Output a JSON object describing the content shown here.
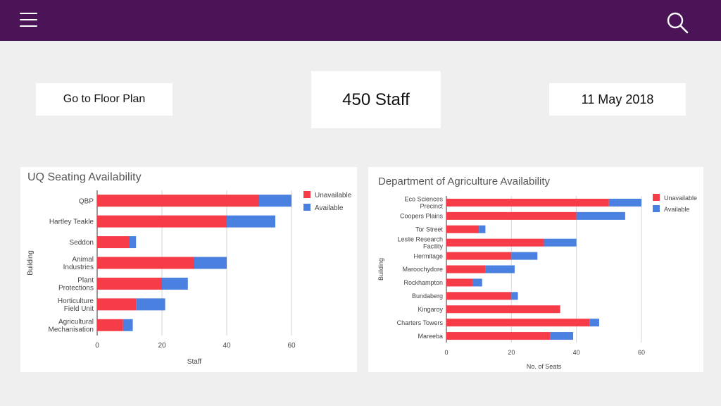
{
  "colors": {
    "header": "#4a1457",
    "unavailable": "#f53c48",
    "available": "#4a80e0"
  },
  "header": {
    "menu_icon": "hamburger-menu-icon",
    "search_icon": "search-icon"
  },
  "floor_plan_button": "Go to Floor Plan",
  "staff_count": "450 Staff",
  "date": "11 May 2018",
  "chart_data": [
    {
      "type": "bar",
      "orientation": "horizontal",
      "stacked": true,
      "title": "UQ Seating Availability",
      "xlabel": "Staff",
      "ylabel": "Building",
      "categories": [
        [
          "QBP"
        ],
        [
          "Hartley Teakle"
        ],
        [
          "Seddon"
        ],
        [
          "Animal",
          "Industries"
        ],
        [
          "Plant",
          "Protections"
        ],
        [
          "Horticulture",
          "Field Unit"
        ],
        [
          "Agricultural",
          "Mechanisation"
        ]
      ],
      "series": [
        {
          "name": "Unavailable",
          "values": [
            50,
            40,
            10,
            30,
            20,
            12,
            8
          ]
        },
        {
          "name": "Available",
          "values": [
            10,
            15,
            2,
            10,
            8,
            9,
            3
          ]
        }
      ],
      "xlim": [
        0,
        60
      ],
      "ticks": [
        0,
        20,
        40,
        60
      ],
      "grid": true,
      "legend": "top-right"
    },
    {
      "type": "bar",
      "orientation": "horizontal",
      "stacked": true,
      "title": "Department of Agriculture Availability",
      "xlabel": "No. of Seats",
      "ylabel": "Building",
      "categories": [
        [
          "Eco Sciences",
          "Precinct"
        ],
        [
          "Coopers Plains"
        ],
        [
          "Tor Street"
        ],
        [
          "Leslie Research",
          "Facility"
        ],
        [
          "Hermitage"
        ],
        [
          "Maroochydore"
        ],
        [
          "Rockhampton"
        ],
        [
          "Bundaberg"
        ],
        [
          "Kingaroy"
        ],
        [
          "Charters Towers"
        ],
        [
          "Mareeba"
        ]
      ],
      "series": [
        {
          "name": "Unavailable",
          "values": [
            50,
            40,
            10,
            30,
            20,
            12,
            8,
            20,
            35,
            44,
            32
          ]
        },
        {
          "name": "Available",
          "values": [
            10,
            15,
            2,
            10,
            8,
            9,
            3,
            2,
            0,
            3,
            7
          ]
        }
      ],
      "xlim": [
        0,
        60
      ],
      "ticks": [
        0,
        20,
        40,
        60
      ],
      "grid": true,
      "legend": "top-right"
    }
  ]
}
